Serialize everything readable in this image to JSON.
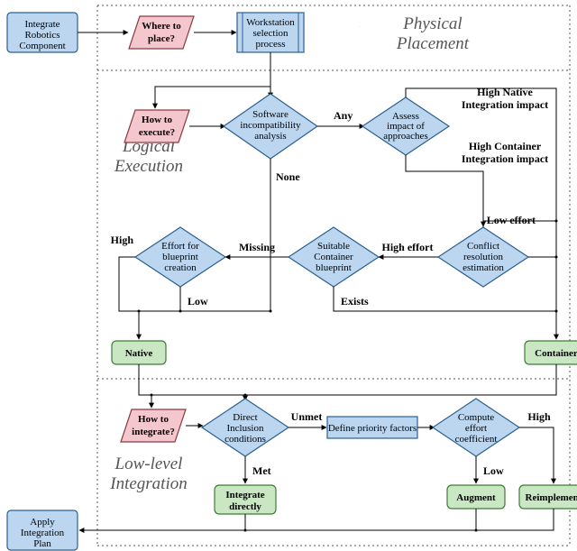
{
  "sections": {
    "physical": "Physical Placement",
    "logical1": "Logical",
    "logical2": "Execution",
    "lowlevel1": "Low-level",
    "lowlevel2": "Integration"
  },
  "nodes": {
    "integrate_robotics1": "Integrate",
    "integrate_robotics2": "Robotics",
    "integrate_robotics3": "Component",
    "where_to_place1": "Where to",
    "where_to_place2": "place?",
    "workstation1": "Workstation",
    "workstation2": "selection",
    "workstation3": "process",
    "how_to_execute1": "How to",
    "how_to_execute2": "execute?",
    "sw_incompat1": "Software",
    "sw_incompat2": "incompatibility",
    "sw_incompat3": "analysis",
    "assess1": "Assess",
    "assess2": "impact of",
    "assess3": "approaches",
    "effort_bp1": "Effort for",
    "effort_bp2": "blueprint",
    "effort_bp3": "creation",
    "suitable1": "Suitable",
    "suitable2": "Container",
    "suitable3": "blueprint",
    "conflict1": "Conflict",
    "conflict2": "resolution",
    "conflict3": "estimation",
    "native": "Native",
    "container": "Container",
    "how_to_integrate1": "How to",
    "how_to_integrate2": "integrate?",
    "direct_incl1": "Direct",
    "direct_incl2": "Inclusion",
    "direct_incl3": "conditions",
    "define_priority": "Define priority factors",
    "compute_effort1": "Compute",
    "compute_effort2": "effort",
    "compute_effort3": "coefficient",
    "integrate_directly1": "Integrate",
    "integrate_directly2": "directly",
    "augment": "Augment",
    "reimplement": "Reimplement",
    "apply_plan1": "Apply",
    "apply_plan2": "Integration",
    "apply_plan3": "Plan"
  },
  "edges": {
    "any": "Any",
    "none": "None",
    "high_native1": "High Native",
    "high_native2": "Integration impact",
    "high_container1": "High Container",
    "high_container2": "Integration impact",
    "low_effort": "Low effort",
    "high_effort": "High effort",
    "missing": "Missing",
    "exists": "Exists",
    "high": "High",
    "low": "Low",
    "unmet": "Unmet",
    "met": "Met",
    "low2": "Low",
    "high2": "High"
  },
  "colors": {
    "process_fill": "#bcd6f0",
    "process_stroke": "#2b5f8f",
    "decision_fill": "#f4c6cd",
    "decision_stroke": "#8a3a3f",
    "diamond_fill": "#bcd6f0",
    "diamond_stroke": "#2b5f8f",
    "terminal_fill": "#c9e7c2",
    "terminal_stroke": "#3f7a36"
  }
}
